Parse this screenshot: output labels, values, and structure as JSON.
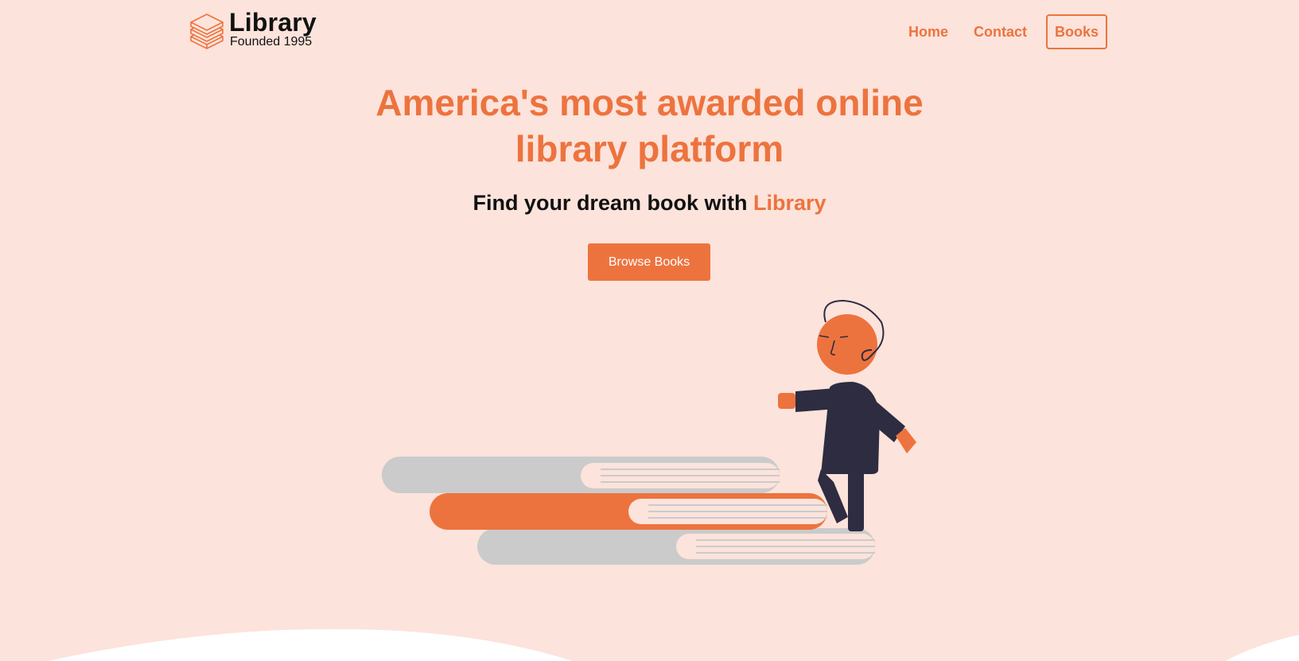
{
  "brand": {
    "name": "Library",
    "tagline": "Founded 1995",
    "icon": "stacked-books-icon"
  },
  "nav": {
    "items": [
      {
        "label": "Home"
      },
      {
        "label": "Contact"
      },
      {
        "label": "Books"
      }
    ]
  },
  "hero": {
    "title_line1": "America's most awarded online",
    "title_line2": "library platform",
    "subtitle_prefix": "Find your dream book with ",
    "subtitle_accent": "Library",
    "cta_label": "Browse Books"
  },
  "illustration": {
    "name": "person-walking-on-books-illustration"
  },
  "colors": {
    "background": "#fce3db",
    "accent": "#ed733e",
    "dark": "#2e2c40",
    "gray_book": "#cbcbcb",
    "white": "#ffffff"
  }
}
